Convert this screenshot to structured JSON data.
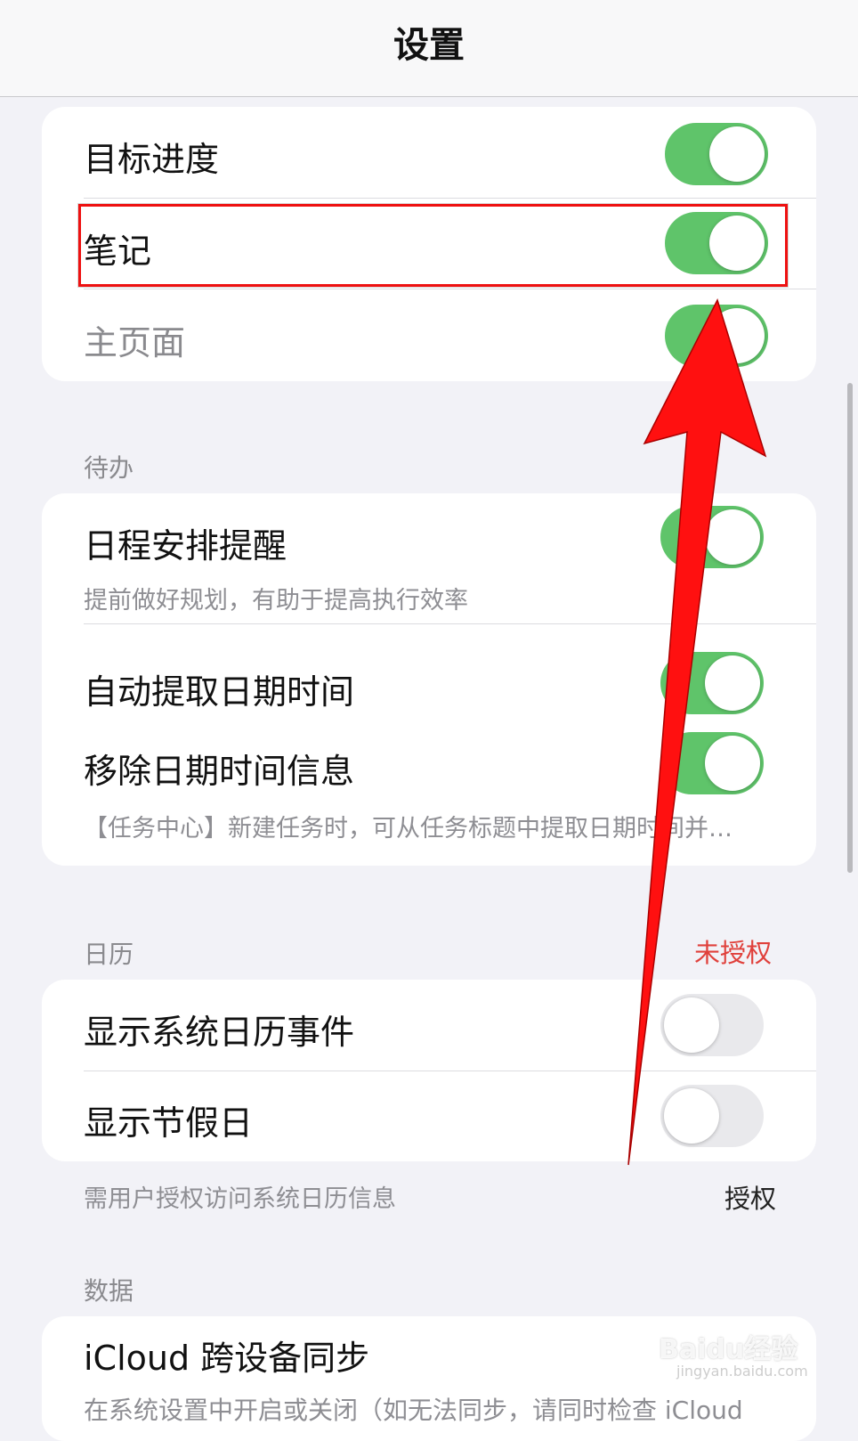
{
  "nav": {
    "title": "设置"
  },
  "group1": {
    "rows": [
      {
        "label": "目标进度",
        "on": true
      },
      {
        "label": "笔记",
        "on": true
      },
      {
        "label": "主页面",
        "on": true
      }
    ]
  },
  "todo": {
    "header": "待办",
    "schedule": {
      "label": "日程安排提醒",
      "desc": "提前做好规划，有助于提高执行效率",
      "on": true
    },
    "extract": {
      "label": "自动提取日期时间",
      "on": true
    },
    "remove": {
      "label": "移除日期时间信息",
      "desc": "【任务中心】新建任务时，可从任务标题中提取日期时间并…",
      "on": true
    }
  },
  "calendar": {
    "header": "日历",
    "status": "未授权",
    "rows": [
      {
        "label": "显示系统日历事件",
        "on": false
      },
      {
        "label": "显示节假日",
        "on": false
      }
    ],
    "footnote": "需用户授权访问系统日历信息",
    "authorize": "授权"
  },
  "data": {
    "header": "数据",
    "icloud": {
      "label": "iCloud 跨设备同步",
      "desc": "在系统设置中开启或关闭（如无法同步，请同时检查 iCloud"
    }
  },
  "watermark": {
    "text": "Baidu经验",
    "sub": "jingyan.baidu.com"
  },
  "colors": {
    "toggle_on": "#5fc46a",
    "toggle_off": "#e9e9ec",
    "highlight": "#e11111",
    "unauthorized": "#e0403b",
    "background": "#f2f2f7"
  }
}
